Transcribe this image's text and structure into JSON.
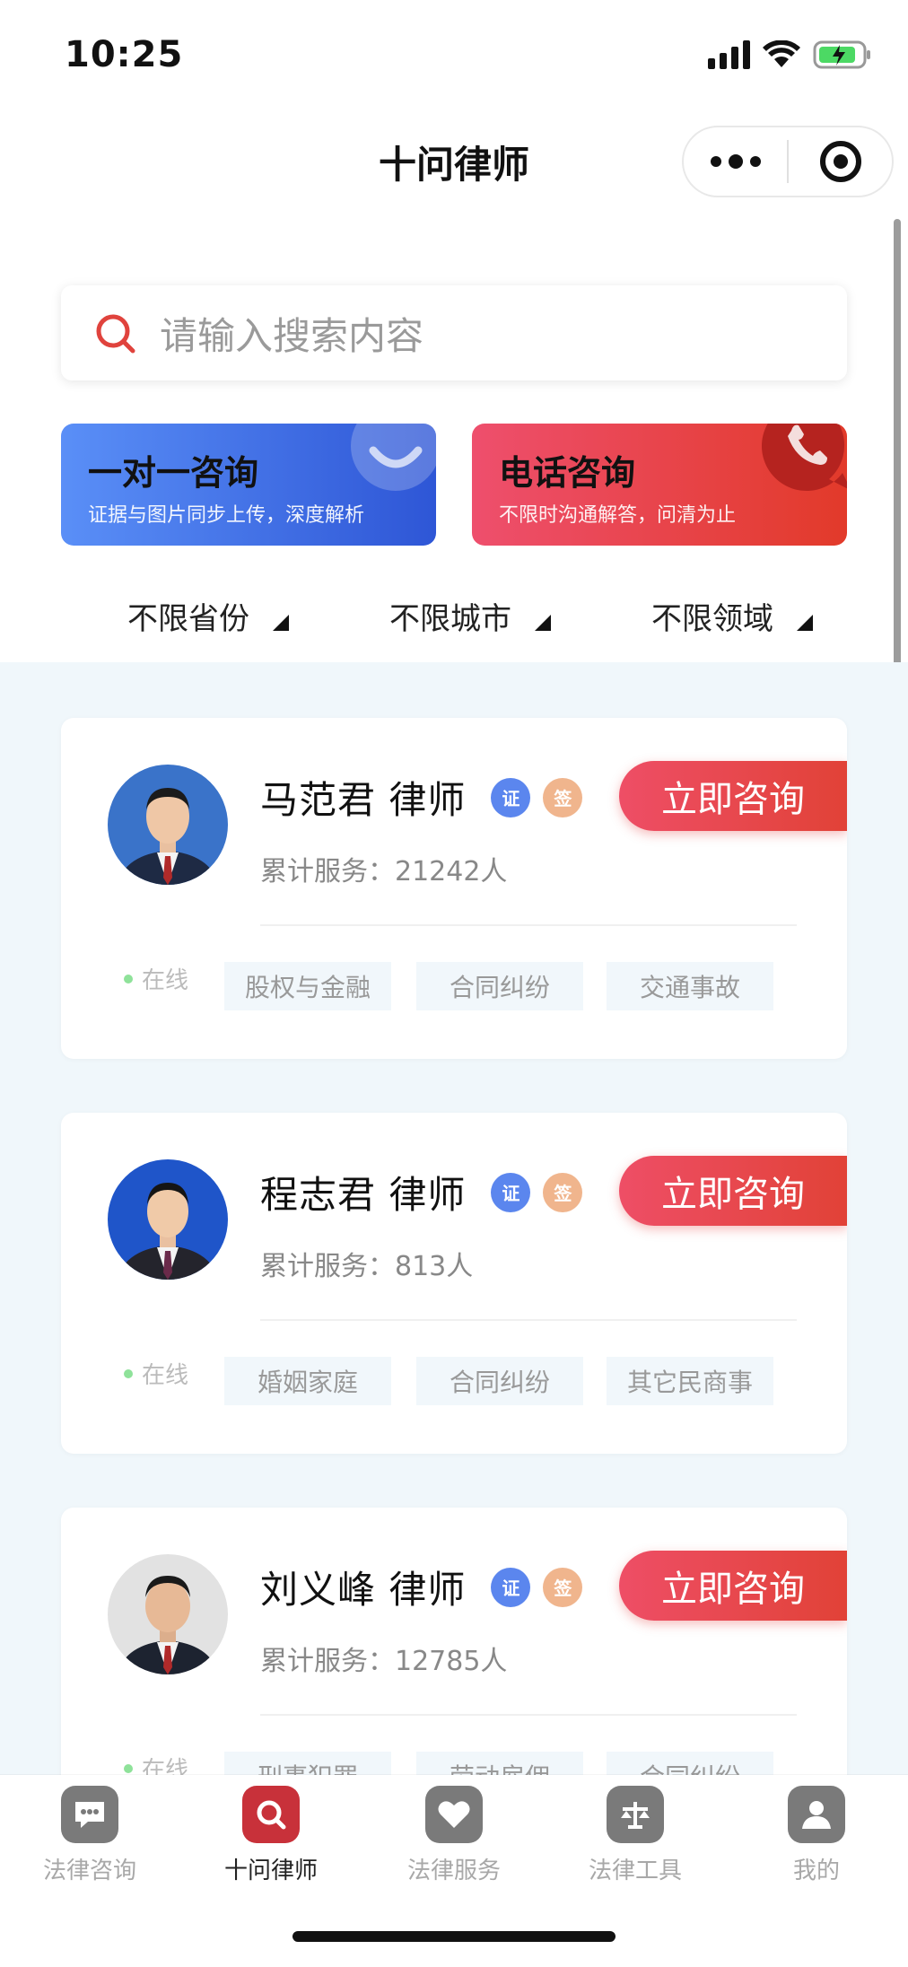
{
  "status_bar": {
    "time": "10:25"
  },
  "header": {
    "title": "十问律师"
  },
  "search": {
    "placeholder": "请输入搜索内容"
  },
  "banners": [
    {
      "title": "一对一咨询",
      "subtitle": "证据与图片同步上传，深度解析"
    },
    {
      "title": "电话咨询",
      "subtitle": "不限时沟通解答，问清为止"
    }
  ],
  "filters": [
    {
      "label": "不限省份"
    },
    {
      "label": "不限城市"
    },
    {
      "label": "不限领域"
    }
  ],
  "lawyers": [
    {
      "name": "马范君 律师",
      "badge_cert": "证",
      "badge_sign": "签",
      "consult_label": "立即咨询",
      "service": "累计服务：21242人",
      "status": "在线",
      "tags": [
        "股权与金融",
        "合同纠纷",
        "交通事故"
      ]
    },
    {
      "name": "程志君 律师",
      "badge_cert": "证",
      "badge_sign": "签",
      "consult_label": "立即咨询",
      "service": "累计服务：813人",
      "status": "在线",
      "tags": [
        "婚姻家庭",
        "合同纠纷",
        "其它民商事"
      ]
    },
    {
      "name": "刘义峰 律师",
      "badge_cert": "证",
      "badge_sign": "签",
      "consult_label": "立即咨询",
      "service": "累计服务：12785人",
      "status": "在线",
      "tags": [
        "刑事犯罪",
        "劳动雇佣",
        "合同纠纷"
      ]
    }
  ],
  "tab_bar": {
    "items": [
      {
        "label": "法律咨询",
        "icon": "chat-icon"
      },
      {
        "label": "十问律师",
        "icon": "search-icon"
      },
      {
        "label": "法律服务",
        "icon": "heart-icon"
      },
      {
        "label": "法律工具",
        "icon": "scales-icon"
      },
      {
        "label": "我的",
        "icon": "user-icon"
      }
    ],
    "active_index": 1
  },
  "colors": {
    "accent_red": "#e14237",
    "accent_blue": "#2e56d6",
    "list_bg": "#f0f7fb"
  }
}
